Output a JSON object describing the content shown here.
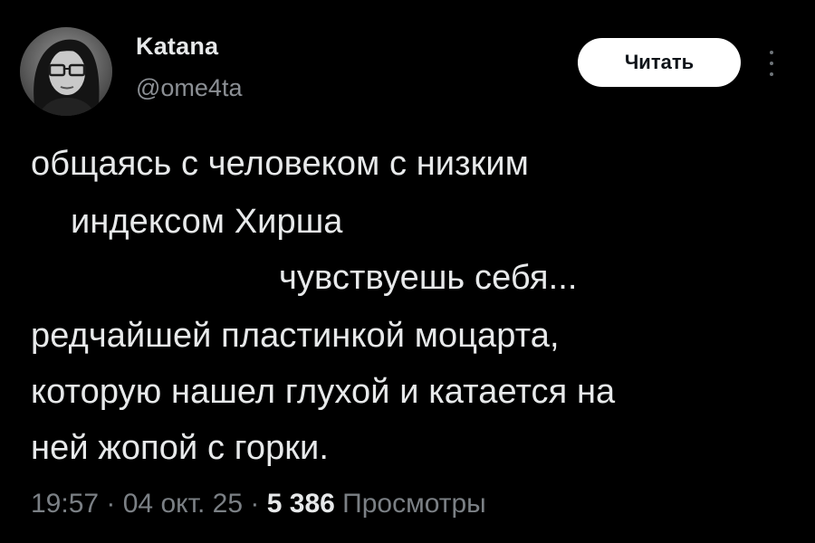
{
  "author": {
    "display_name": "Katana",
    "handle": "@ome4ta",
    "avatar_icon": "user-avatar-photo"
  },
  "actions": {
    "follow_label": "Читать",
    "more_icon": "more-vertical-icon"
  },
  "tweet": {
    "lines": [
      "общаясь с человеком с низким",
      "индексом Хирша",
      "чувствуешь себя...",
      "редчайшей пластинкой моцарта,",
      "которую нашел глухой и катается на",
      "ней жопой с горки."
    ]
  },
  "meta": {
    "time": "19:57",
    "separator": " · ",
    "date": "04 окт. 25",
    "views_count": "5 386",
    "views_label": "Просмотры"
  },
  "colors": {
    "background": "#000000",
    "text_primary": "#e7e9ea",
    "text_secondary": "#7b8085",
    "button_bg": "#ffffff",
    "button_text": "#0f1419"
  }
}
